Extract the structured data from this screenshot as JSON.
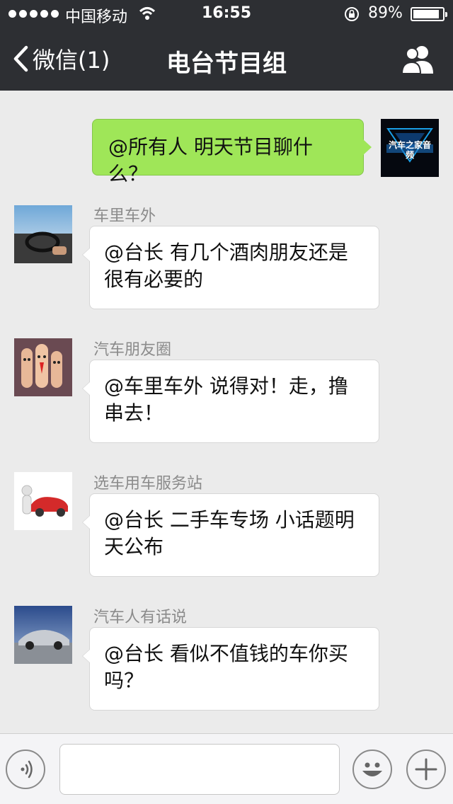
{
  "status_bar": {
    "carrier": "中国移动",
    "time": "16:55",
    "battery_percent": "89%"
  },
  "nav": {
    "back_label": "微信(1)",
    "title": "电台节目组"
  },
  "my_message": {
    "text": "@所有人 明天节目聊什么？",
    "avatar_text": "汽车之家音频"
  },
  "messages": [
    {
      "sender": "车里车外",
      "text": "@台长 有几个酒肉朋友还是很有必要的"
    },
    {
      "sender": "汽车朋友圈",
      "text": "@车里车外 说得对！走，撸串去！"
    },
    {
      "sender": "选车用车服务站",
      "text": "@台长 二手车专场 小话题明天公布"
    },
    {
      "sender": "汽车人有话说",
      "text": "@台长 看似不值钱的车你买吗？"
    }
  ],
  "input": {
    "value": "",
    "placeholder": ""
  },
  "icons": {
    "voice": "voice-icon",
    "emoji": "emoji-icon",
    "plus": "plus-icon",
    "back": "chevron-left-icon",
    "group": "group-members-icon"
  },
  "colors": {
    "nav_bg": "#2d2f33",
    "chat_bg": "#ebebeb",
    "my_bubble": "#9fe658",
    "other_bubble": "#ffffff"
  }
}
